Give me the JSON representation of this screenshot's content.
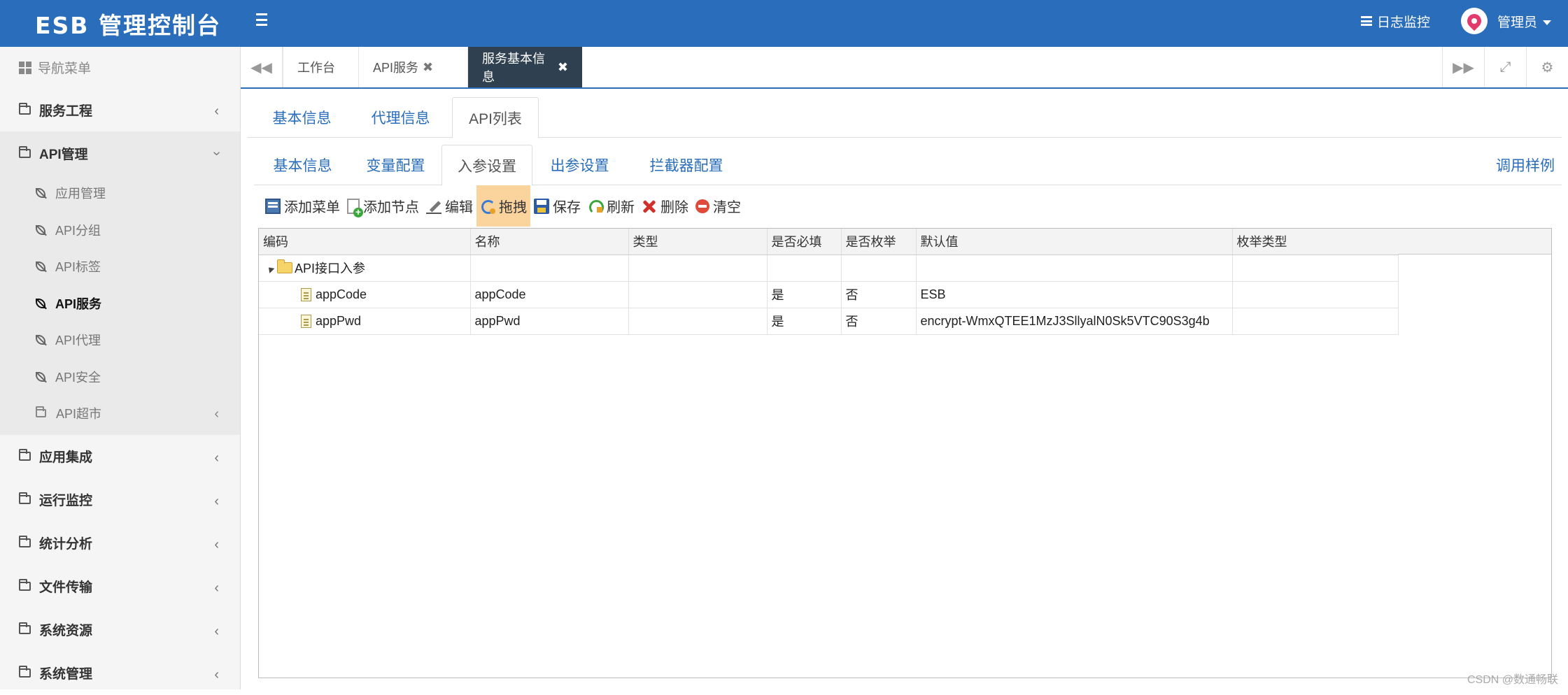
{
  "header": {
    "brand": "ESB 管理控制台",
    "log_monitor": "日志监控",
    "user": "管理员"
  },
  "sidebar": {
    "title": "导航菜单",
    "items": [
      {
        "label": "服务工程"
      },
      {
        "label": "API管理"
      },
      {
        "label": "应用集成"
      },
      {
        "label": "运行监控"
      },
      {
        "label": "统计分析"
      },
      {
        "label": "文件传输"
      },
      {
        "label": "系统资源"
      },
      {
        "label": "系统管理"
      }
    ],
    "api_sub": [
      {
        "label": "应用管理"
      },
      {
        "label": "API分组"
      },
      {
        "label": "API标签"
      },
      {
        "label": "API服务"
      },
      {
        "label": "API代理"
      },
      {
        "label": "API安全"
      },
      {
        "label": "API超市"
      }
    ]
  },
  "tabstrip": {
    "tabs": [
      {
        "label": "工作台"
      },
      {
        "label": "API服务"
      },
      {
        "label": "服务基本信息"
      }
    ]
  },
  "outer_tabs": [
    {
      "label": "基本信息"
    },
    {
      "label": "代理信息"
    },
    {
      "label": "API列表"
    }
  ],
  "inner_tabs": [
    {
      "label": "基本信息"
    },
    {
      "label": "变量配置"
    },
    {
      "label": "入参设置"
    },
    {
      "label": "出参设置"
    },
    {
      "label": "拦截器配置"
    }
  ],
  "call_sample": "调用样例",
  "toolbar": {
    "add_menu": "添加菜单",
    "add_node": "添加节点",
    "edit": "编辑",
    "drag": "拖拽",
    "save": "保存",
    "refresh": "刷新",
    "delete": "删除",
    "clear": "清空"
  },
  "grid": {
    "columns": [
      "编码",
      "名称",
      "类型",
      "是否必填",
      "是否枚举",
      "默认值",
      "枚举类型"
    ],
    "root": {
      "code": "API接口入参"
    },
    "rows": [
      {
        "code": "appCode",
        "name": "appCode",
        "type": "",
        "required": "是",
        "enum": "否",
        "default": "ESB",
        "enum_type": ""
      },
      {
        "code": "appPwd",
        "name": "appPwd",
        "type": "",
        "required": "是",
        "enum": "否",
        "default": "encrypt-WmxQTEE1MzJ3SllyalN0Sk5VTC90S3g4b",
        "enum_type": ""
      }
    ]
  },
  "watermark": "CSDN @数通畅联"
}
